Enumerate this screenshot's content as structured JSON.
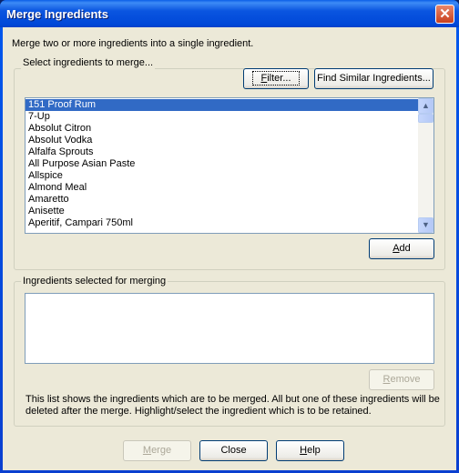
{
  "window": {
    "title": "Merge Ingredients",
    "close_icon": "close-icon"
  },
  "intro": "Merge two or more ingredients into a single ingredient.",
  "select_group": {
    "label": "Select ingredients to merge...",
    "filter_label": "Filter...",
    "find_similar_label": "Find Similar Ingredients...",
    "add_label": "Add",
    "items": [
      "151 Proof Rum",
      "7-Up",
      "Absolut Citron",
      "Absolut Vodka",
      "Alfalfa Sprouts",
      "All Purpose Asian Paste",
      "Allspice",
      "Almond Meal",
      "Amaretto",
      "Anisette",
      "Aperitif, Campari  750ml"
    ],
    "selected_index": 0
  },
  "merge_group": {
    "label": "Ingredients selected for merging",
    "items": [],
    "remove_label": "Remove",
    "description_line1": "This list shows the ingredients which are to be merged.  All but one of these ingredients will be",
    "description_line2": "deleted after the merge.  Highlight/select the ingredient which is to be retained."
  },
  "footer": {
    "merge_label": "Merge",
    "close_label": "Close",
    "help_label": "Help"
  },
  "colors": {
    "titlebar": "#0058ee",
    "selection": "#316ac5",
    "dialog_bg": "#ece9d8"
  }
}
